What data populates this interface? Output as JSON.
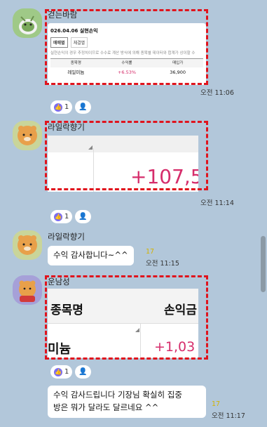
{
  "messages": [
    {
      "sender": "걷는바람",
      "card": {
        "title": "026.04.06 실현손익",
        "tabs": [
          "매매별",
          "체결별"
        ],
        "note": "실현손익의 경우 추정치이므로 수수료 계산 방식에 의해 종목별 데이터와 합계가 상이할 수",
        "headers": [
          "종목명",
          "수익률",
          "매입가"
        ],
        "row": {
          "name": "레일미늄",
          "rate": "+6.53%",
          "price": "36,900"
        }
      },
      "time": "오전 11:06",
      "reaction_count": "1"
    },
    {
      "sender": "라일락향기",
      "card": {
        "value": "+107,5"
      },
      "time": "오전 11:14",
      "reaction_count": "1"
    },
    {
      "sender": "라일락향기",
      "bubble": "수익  감사합니다~^^",
      "read": "17",
      "time": "오전 11:15"
    },
    {
      "sender": "운남성",
      "card": {
        "header_left": "종목명",
        "header_right": "손익금",
        "name": "미늄",
        "value": "+1,03"
      },
      "reaction_count": "1"
    },
    {
      "bubble_lines": [
        "수익 감사드립니다 기장님 확실히 집중",
        "방은 뭐가 달라도 달르네요 ^^"
      ],
      "read": "17",
      "time": "오전 11:17"
    }
  ],
  "colors": {
    "background": "#b2c7da",
    "highlight": "#e0141d",
    "positive": "#d62d6b",
    "unread": "#d3b300"
  }
}
